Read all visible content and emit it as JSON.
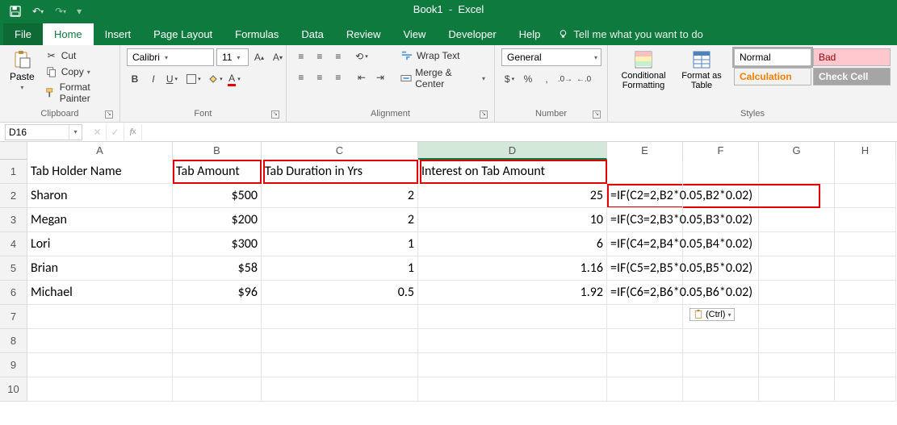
{
  "title": {
    "name": "Book1",
    "app": "Excel"
  },
  "qat": {
    "undo": "↶",
    "redo": "↷"
  },
  "menutabs": {
    "file": "File",
    "home": "Home",
    "insert": "Insert",
    "pagelayout": "Page Layout",
    "formulas": "Formulas",
    "data": "Data",
    "review": "Review",
    "view": "View",
    "developer": "Developer",
    "help": "Help",
    "tellme": "Tell me what you want to do"
  },
  "ribbon": {
    "clipboard": {
      "paste": "Paste",
      "cut": "Cut",
      "copy": "Copy",
      "fmtpainter": "Format Painter",
      "label": "Clipboard"
    },
    "font": {
      "name": "Calibri",
      "size": "11",
      "label": "Font"
    },
    "alignment": {
      "wraptext": "Wrap Text",
      "merge": "Merge & Center",
      "label": "Alignment"
    },
    "number": {
      "format": "General",
      "label": "Number"
    },
    "styles": {
      "cf": "Conditional Formatting",
      "fat": "Format as Table",
      "normal": "Normal",
      "bad": "Bad",
      "calc": "Calculation",
      "check": "Check Cell",
      "label": "Styles"
    }
  },
  "fxbar": {
    "namebox": "D16",
    "formula": ""
  },
  "cols": [
    "A",
    "B",
    "C",
    "D",
    "E",
    "F",
    "G",
    "H"
  ],
  "rows": [
    {
      "n": "1",
      "A": "Tab Holder Name",
      "B": "Tab Amount",
      "C": "Tab Duration in Yrs",
      "D": "Interest on Tab Amount",
      "E": "",
      "F": "",
      "G": "",
      "H": ""
    },
    {
      "n": "2",
      "A": "Sharon",
      "B": "$500",
      "C": "2",
      "D": "25",
      "E": "=IF(C2=2,B2*0.05,B2*0.02)",
      "F": "",
      "G": "",
      "H": ""
    },
    {
      "n": "3",
      "A": "Megan",
      "B": "$200",
      "C": "2",
      "D": "10",
      "E": "=IF(C3=2,B3*0.05,B3*0.02)",
      "F": "",
      "G": "",
      "H": ""
    },
    {
      "n": "4",
      "A": "Lori",
      "B": "$300",
      "C": "1",
      "D": "6",
      "E": "=IF(C4=2,B4*0.05,B4*0.02)",
      "F": "",
      "G": "",
      "H": ""
    },
    {
      "n": "5",
      "A": "Brian",
      "B": "$58",
      "C": "1",
      "D": "1.16",
      "E": "=IF(C5=2,B5*0.05,B5*0.02)",
      "F": "",
      "G": "",
      "H": ""
    },
    {
      "n": "6",
      "A": "Michael",
      "B": "$96",
      "C": "0.5",
      "D": "1.92",
      "E": "=IF(C6=2,B6*0.05,B6*0.02)",
      "F": "",
      "G": "",
      "H": ""
    },
    {
      "n": "7",
      "A": "",
      "B": "",
      "C": "",
      "D": "",
      "E": "",
      "F": "",
      "G": "",
      "H": ""
    },
    {
      "n": "8",
      "A": "",
      "B": "",
      "C": "",
      "D": "",
      "E": "",
      "F": "",
      "G": "",
      "H": ""
    },
    {
      "n": "9",
      "A": "",
      "B": "",
      "C": "",
      "D": "",
      "E": "",
      "F": "",
      "G": "",
      "H": ""
    },
    {
      "n": "10",
      "A": "",
      "B": "",
      "C": "",
      "D": "",
      "E": "",
      "F": "",
      "G": "",
      "H": ""
    }
  ],
  "pastehint": {
    "label": "(Ctrl)"
  }
}
